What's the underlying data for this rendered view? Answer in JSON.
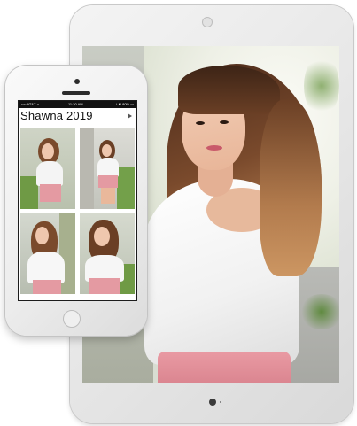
{
  "phone": {
    "status": {
      "carrier": "•••• AT&T ◔",
      "time": "11:30 AM",
      "battery": "↑ ✱ 80% ▭"
    },
    "album_title": "Shawna 2019",
    "icons": {
      "play": "play-icon",
      "camera": "camera-icon",
      "speaker": "speaker-icon",
      "home": "home-button-icon"
    },
    "thumbnails": [
      {
        "label": "photo-1"
      },
      {
        "label": "photo-2"
      },
      {
        "label": "photo-3"
      },
      {
        "label": "photo-4"
      }
    ]
  },
  "tablet": {
    "icons": {
      "camera": "camera-icon",
      "home": "home-button-icon"
    }
  },
  "colors": {
    "device_frame": "#ececec",
    "screen_bezel": "#1c1c1c",
    "status_bar": "#111111",
    "title_text": "#111111",
    "accent_pink": "#e99aa3"
  }
}
